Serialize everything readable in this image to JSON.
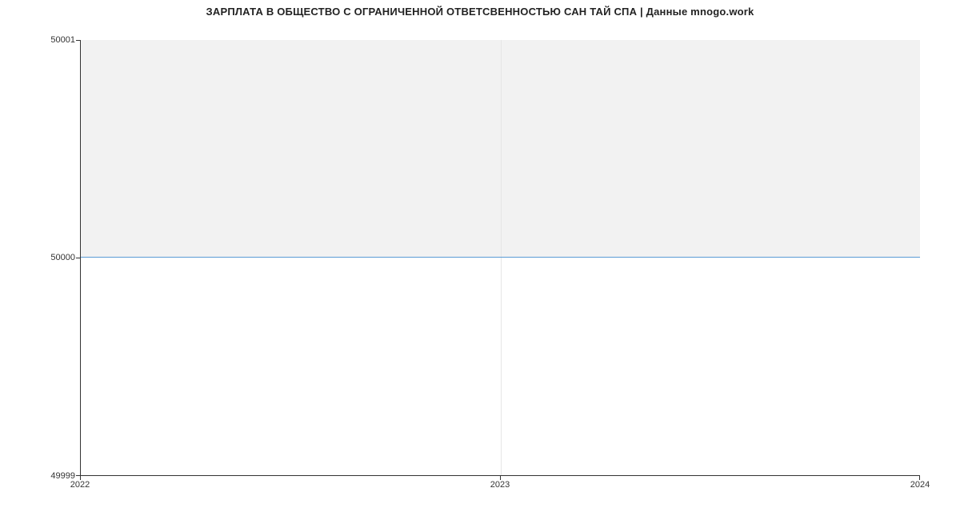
{
  "chart_data": {
    "type": "area",
    "title": "ЗАРПЛАТА В ОБЩЕСТВО С ОГРАНИЧЕННОЙ ОТВЕТСВЕННОСТЬЮ САН ТАЙ СПА | Данные mnogo.work",
    "x": [
      2022,
      2023,
      2024
    ],
    "values": [
      50000,
      50000,
      50000
    ],
    "xlabel": "",
    "ylabel": "",
    "xlim": [
      2022,
      2024
    ],
    "ylim": [
      49999,
      50001
    ],
    "x_ticks": [
      "2022",
      "2023",
      "2024"
    ],
    "y_ticks": [
      "49999",
      "50000",
      "50001"
    ],
    "line_color": "#5b9bd5",
    "fill_color": "#f2f2f2"
  }
}
